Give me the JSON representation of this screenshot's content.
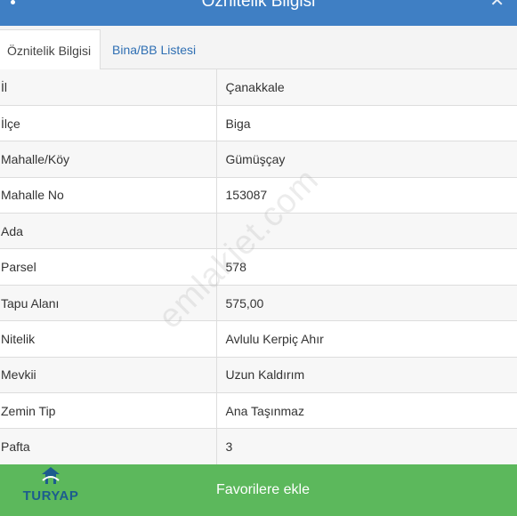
{
  "window": {
    "title": "Öznitelik Bilgisi",
    "menu_icon": "vertical-dots-icon",
    "close_icon": "close-icon",
    "accent_color": "#3f7fc4"
  },
  "tabs": [
    {
      "label": "Öznitelik Bilgisi",
      "active": true
    },
    {
      "label": "Bina/BB Listesi",
      "active": false
    }
  ],
  "rows": [
    {
      "key": "İl",
      "value": "Çanakkale"
    },
    {
      "key": "İlçe",
      "value": "Biga"
    },
    {
      "key": "Mahalle/Köy",
      "value": "Gümüşçay"
    },
    {
      "key": "Mahalle No",
      "value": "153087"
    },
    {
      "key": "Ada",
      "value": ""
    },
    {
      "key": "Parsel",
      "value": "578"
    },
    {
      "key": "Tapu Alanı",
      "value": "575,00"
    },
    {
      "key": "Nitelik",
      "value": "Avlulu Kerpiç Ahır"
    },
    {
      "key": "Mevkii",
      "value": "Uzun Kaldırım"
    },
    {
      "key": "Zemin Tip",
      "value": "Ana Taşınmaz"
    },
    {
      "key": "Pafta",
      "value": "3"
    }
  ],
  "watermark": "emlakjet.com",
  "footer": {
    "button_label": "Favorilere ekle",
    "logo_text": "TURYAP",
    "button_color": "#5cb85c"
  }
}
